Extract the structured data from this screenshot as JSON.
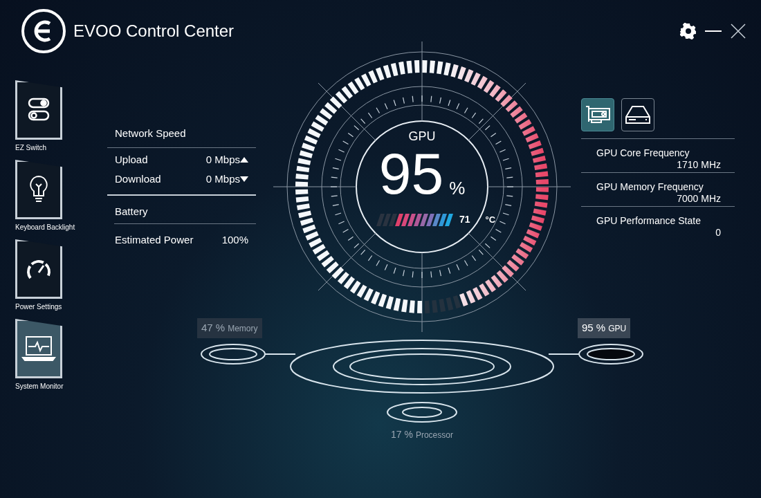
{
  "window": {
    "title": "EVOO Control Center"
  },
  "sidebar": {
    "items": [
      {
        "label": "EZ Switch",
        "kind": "switch",
        "selected": false
      },
      {
        "label": "Keyboard Backlight",
        "kind": "bulb",
        "selected": false
      },
      {
        "label": "Power Settings",
        "kind": "speedometer",
        "selected": false
      },
      {
        "label": "System Monitor",
        "kind": "monitor",
        "selected": true
      }
    ]
  },
  "network": {
    "title": "Network Speed",
    "rows": [
      {
        "label": "Upload",
        "value": "0 Mbps",
        "kind": "up"
      },
      {
        "label": "Download",
        "value": "0 Mbps",
        "kind": "down"
      }
    ]
  },
  "battery": {
    "title": "Battery",
    "rows": [
      {
        "label": "Estimated Power",
        "value": "100%"
      }
    ]
  },
  "gauge": {
    "label": "GPU",
    "value": "95",
    "unit": "%",
    "level": 0.95,
    "temperature": {
      "value": "71",
      "unit": "°C",
      "level": 0.71
    }
  },
  "device_tabs": [
    {
      "kind": "gpu",
      "selected": true
    },
    {
      "kind": "drive",
      "selected": false
    }
  ],
  "gpu_stats": [
    {
      "label": "GPU Core Frequency",
      "value": "1710 MHz"
    },
    {
      "label": "GPU Memory Frequency",
      "value": "7000 MHz"
    },
    {
      "label": "GPU Performance State",
      "value": "0"
    }
  ],
  "nodes": [
    {
      "kind": "memory",
      "value": "47 %",
      "label": "Memory",
      "selected": false
    },
    {
      "kind": "gpu",
      "value": "95 %",
      "label": "GPU",
      "selected": true
    },
    {
      "kind": "processor",
      "value": "17 %",
      "label": "Processor",
      "selected": false
    }
  ]
}
